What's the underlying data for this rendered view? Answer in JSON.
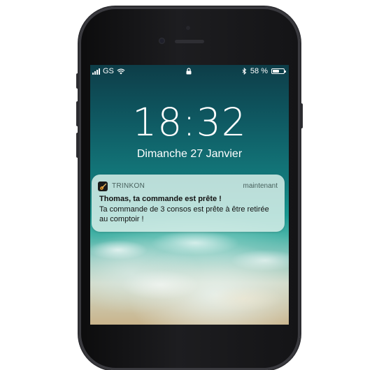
{
  "status_bar": {
    "carrier": "GS",
    "signal_icon": "signal-bars-icon",
    "wifi_icon": "wifi-icon",
    "lock_icon": "lock-icon",
    "bluetooth_icon": "bluetooth-icon",
    "battery_percent": "58 %",
    "battery_level": 0.58
  },
  "lock_screen": {
    "time": "18:32",
    "date": "Dimanche 27 Janvier"
  },
  "notification": {
    "app_icon": "guitar-icon",
    "app_name": "TRINKON",
    "time": "maintenant",
    "title": "Thomas, ta commande est prête !",
    "body": "Ta commande de 3 consos est prête à être retirée au comptoir !"
  }
}
